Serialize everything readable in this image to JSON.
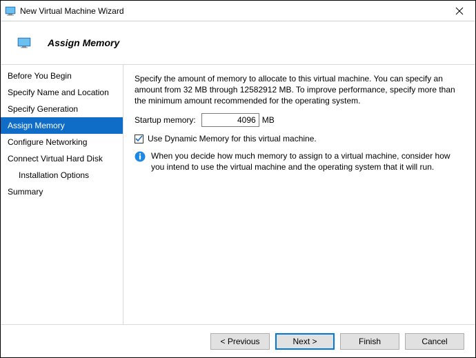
{
  "window": {
    "title": "New Virtual Machine Wizard"
  },
  "header": {
    "title": "Assign Memory"
  },
  "steps": [
    {
      "label": "Before You Begin"
    },
    {
      "label": "Specify Name and Location"
    },
    {
      "label": "Specify Generation"
    },
    {
      "label": "Assign Memory",
      "active": true
    },
    {
      "label": "Configure Networking"
    },
    {
      "label": "Connect Virtual Hard Disk"
    },
    {
      "label": "Installation Options",
      "sub": true
    },
    {
      "label": "Summary"
    }
  ],
  "content": {
    "description": "Specify the amount of memory to allocate to this virtual machine. You can specify an amount from 32 MB through 12582912 MB. To improve performance, specify more than the minimum amount recommended for the operating system.",
    "startup_label": "Startup memory:",
    "startup_value": "4096",
    "startup_unit": "MB",
    "dynamic_label": "Use Dynamic Memory for this virtual machine.",
    "dynamic_checked": true,
    "info_text": "When you decide how much memory to assign to a virtual machine, consider how you intend to use the virtual machine and the operating system that it will run."
  },
  "buttons": {
    "previous": "< Previous",
    "next": "Next >",
    "finish": "Finish",
    "cancel": "Cancel"
  }
}
